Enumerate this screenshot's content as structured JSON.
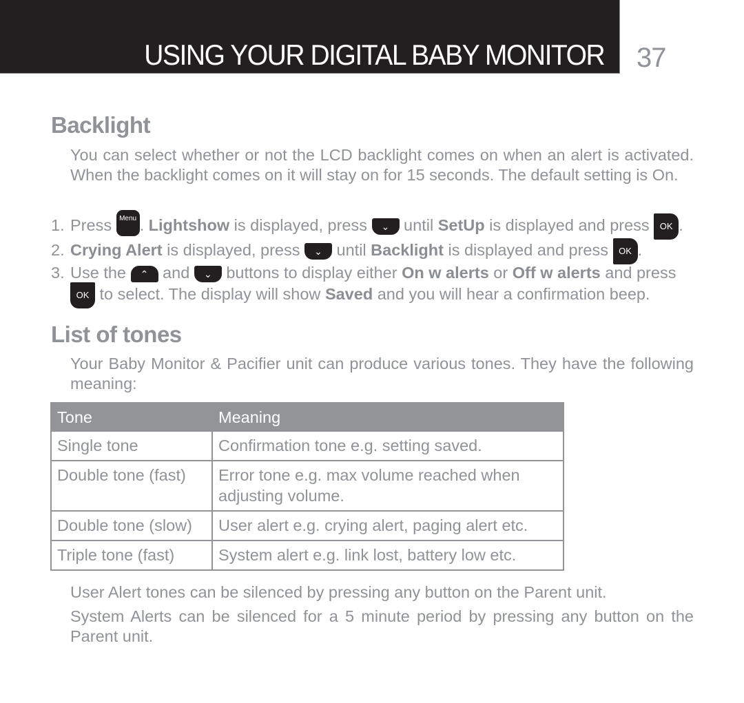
{
  "header": {
    "title": "USING YOUR DIGITAL BABY MONITOR",
    "page_number": "37"
  },
  "backlight": {
    "heading": "Backlight",
    "intro": "You can select whether or not the LCD backlight comes on when an alert is activated. When the backlight comes on it will stay on for 15 seconds. The default setting is On.",
    "steps": [
      {
        "num": "1.",
        "t1": "Press ",
        "key1": "Menu",
        "t2": ". ",
        "b1": "Lightshow",
        "t3": " is displayed, press ",
        "key2": "down-arrow",
        "t4": " until ",
        "b2": "SetUp",
        "t5": " is displayed and press ",
        "key3": "OK",
        "t6": "."
      },
      {
        "num": "2.",
        "b1": "Crying Alert",
        "t1": " is displayed, press ",
        "key1": "down-arrow",
        "t2": " until ",
        "b2": "Backlight",
        "t3": " is displayed and press ",
        "key2": "OK",
        "t4": "."
      },
      {
        "num": "3.",
        "t1": "Use the ",
        "key1": "up-arrow",
        "t2": " and ",
        "key2": "down-arrow",
        "t3": " buttons to display either ",
        "b1": "On w alerts",
        "t4": " or ",
        "b2": "Off w alerts",
        "t5": " and press",
        "key3": "OK",
        "t6": " to select. The display will show ",
        "b3": "Saved",
        "t7": " and you will hear a confirmation beep."
      }
    ],
    "icons": {
      "up": "⌃",
      "down": "⌄"
    }
  },
  "tones": {
    "heading": "List of tones",
    "intro": "Your Baby Monitor & Pacifier unit can produce various tones. They have the following meaning:",
    "table": {
      "headers": [
        "Tone",
        "Meaning"
      ],
      "rows": [
        [
          "Single tone",
          "Confirmation tone e.g. setting saved."
        ],
        [
          "Double tone (fast)",
          "Error tone e.g. max volume reached when adjusting volume."
        ],
        [
          "Double tone (slow)",
          "User alert e.g. crying alert, paging alert etc."
        ],
        [
          "Triple tone (fast)",
          "System alert e.g. link lost, battery low etc."
        ]
      ]
    },
    "notes": [
      "User Alert tones can be silenced by pressing any button on the Parent unit.",
      "System Alerts can be silenced for a 5 minute period by pressing any button on the Parent unit."
    ]
  },
  "colors": {
    "header_band": "#231f20",
    "text_grey": "#8f9297",
    "table_header": "#929497"
  }
}
